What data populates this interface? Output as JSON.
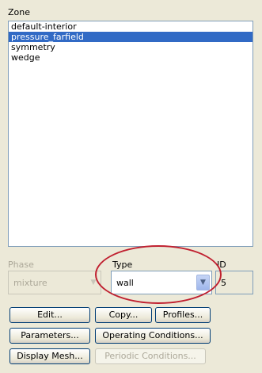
{
  "zone": {
    "label": "Zone",
    "items": [
      {
        "label": "default-interior",
        "selected": false
      },
      {
        "label": "pressure_farfield",
        "selected": true
      },
      {
        "label": "symmetry",
        "selected": false
      },
      {
        "label": "wedge",
        "selected": false
      }
    ]
  },
  "phase": {
    "label": "Phase",
    "value": "mixture",
    "enabled": false
  },
  "type": {
    "label": "Type",
    "value": "wall"
  },
  "id": {
    "label": "ID",
    "value": "5"
  },
  "buttons": {
    "edit": "Edit...",
    "copy": "Copy...",
    "profiles": "Profiles...",
    "parameters": "Parameters...",
    "operating_conditions": "Operating Conditions...",
    "display_mesh": "Display Mesh...",
    "periodic_conditions": "Periodic Conditions..."
  },
  "colors": {
    "selection": "#316ac5",
    "annotation_circle": "#c02030",
    "panel_background": "#ece9d8"
  },
  "icons": {
    "dropdown": "chevron-down-icon"
  }
}
